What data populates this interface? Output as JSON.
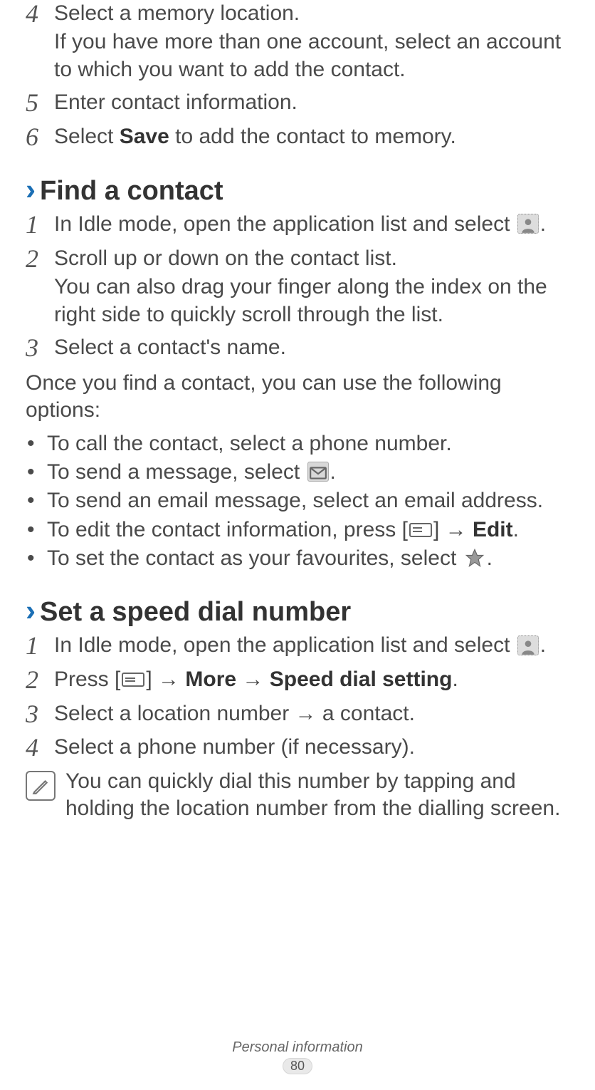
{
  "intro_steps": [
    {
      "num": "4",
      "text": "Select a memory location.",
      "sub": "If you have more than one account, select an account to which you want to add the contact."
    },
    {
      "num": "5",
      "text": "Enter contact information."
    },
    {
      "num": "6",
      "text_pre": "Select ",
      "bold": "Save",
      "text_post": " to add the contact to memory."
    }
  ],
  "find_heading": "Find a contact",
  "find_steps": [
    {
      "num": "1",
      "text_pre": "In Idle mode, open the application list and select ",
      "text_post": "."
    },
    {
      "num": "2",
      "text": "Scroll up or down on the contact list.",
      "sub": "You can also drag your finger along the index on the right side to quickly scroll through the list."
    },
    {
      "num": "3",
      "text": "Select a contact's name."
    }
  ],
  "options_intro": "Once you find a contact, you can use the following options:",
  "options": [
    {
      "text": "To call the contact, select a phone number."
    },
    {
      "text_pre": "To send a message, select ",
      "text_post": "."
    },
    {
      "text": "To send an email message, select an email address."
    },
    {
      "text_pre": "To edit the contact information, press [",
      "text_mid": "] → ",
      "bold": "Edit",
      "text_post": "."
    },
    {
      "text_pre": "To set the contact as your favourites, select ",
      "text_post": "."
    }
  ],
  "speed_heading": "Set a speed dial number",
  "speed_steps": [
    {
      "num": "1",
      "text_pre": "In Idle mode, open the application list and select ",
      "text_post": "."
    },
    {
      "num": "2",
      "text_pre": "Press [",
      "text_mid": "] → ",
      "bold1": "More",
      "arrow": " → ",
      "bold2": "Speed dial setting",
      "text_post": "."
    },
    {
      "num": "3",
      "text": "Select a location number → a contact."
    },
    {
      "num": "4",
      "text": "Select a phone number (if necessary)."
    }
  ],
  "note": "You can quickly dial this number by tapping and holding the location number from the dialling screen.",
  "footer_title": "Personal information",
  "footer_page": "80"
}
